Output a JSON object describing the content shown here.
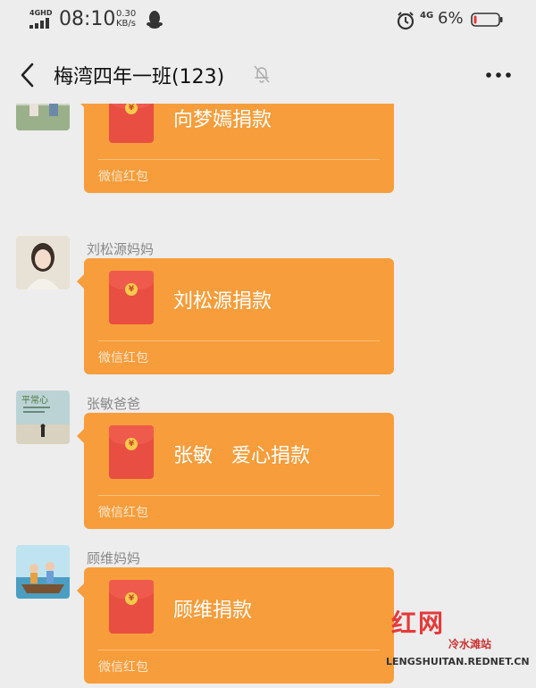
{
  "status_bar": {
    "network": "4GHD",
    "time": "08:10",
    "speed_value": "0.30",
    "speed_unit": "KB/s",
    "network_right": "4G",
    "battery": "6%"
  },
  "header": {
    "title": "梅湾四年一班(123)",
    "icons": {
      "back": "chevron-left-icon",
      "mute": "bell-off-icon",
      "more": "ellipsis-icon"
    }
  },
  "messages": [
    {
      "sender": "",
      "packet_text": "向梦嫣捐款",
      "footer": "微信红包"
    },
    {
      "sender": "刘松源妈妈",
      "packet_text": "刘松源捐款",
      "footer": "微信红包"
    },
    {
      "sender": "张敏爸爸",
      "packet_text": "张敏   爱心捐款",
      "footer": "微信红包"
    },
    {
      "sender": "顾维妈妈",
      "packet_text": "顾维捐款",
      "footer": "微信红包"
    }
  ],
  "avatar_texts": {
    "m2": "平常心"
  },
  "watermark": {
    "logo": "红网",
    "site": "冷水滩站",
    "url": "LENGSHUITAN.REDNET.CN"
  },
  "colors": {
    "background": "#ededed",
    "packet": "#f89d3b",
    "envelope": "#e84e42",
    "watermark_red": "#e53a3a"
  }
}
